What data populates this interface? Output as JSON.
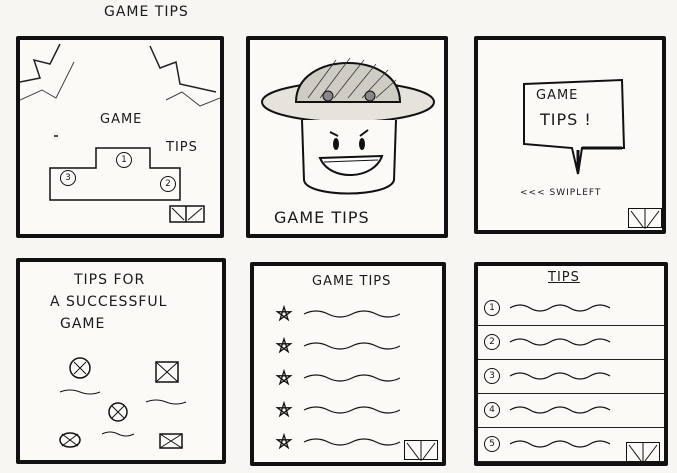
{
  "page_title": "GAME TIPS",
  "frame1": {
    "game": "GAME",
    "tips": "TIPS",
    "podium": [
      "1",
      "2",
      "3"
    ]
  },
  "frame2": {
    "caption": "GAME  TIPS"
  },
  "frame3": {
    "bubble_line1": "GAME",
    "bubble_line2": "TIPS !",
    "swipe": "<<< SWIPLEFT"
  },
  "frame4": {
    "line1": "TIPS FOR",
    "line2": "A SUCCESSFUL",
    "line3": "GAME"
  },
  "frame5": {
    "title": "GAME TIPS",
    "stars": 5
  },
  "frame6": {
    "title": "TIPS",
    "numbers": [
      "1",
      "2",
      "3",
      "4",
      "5"
    ]
  }
}
